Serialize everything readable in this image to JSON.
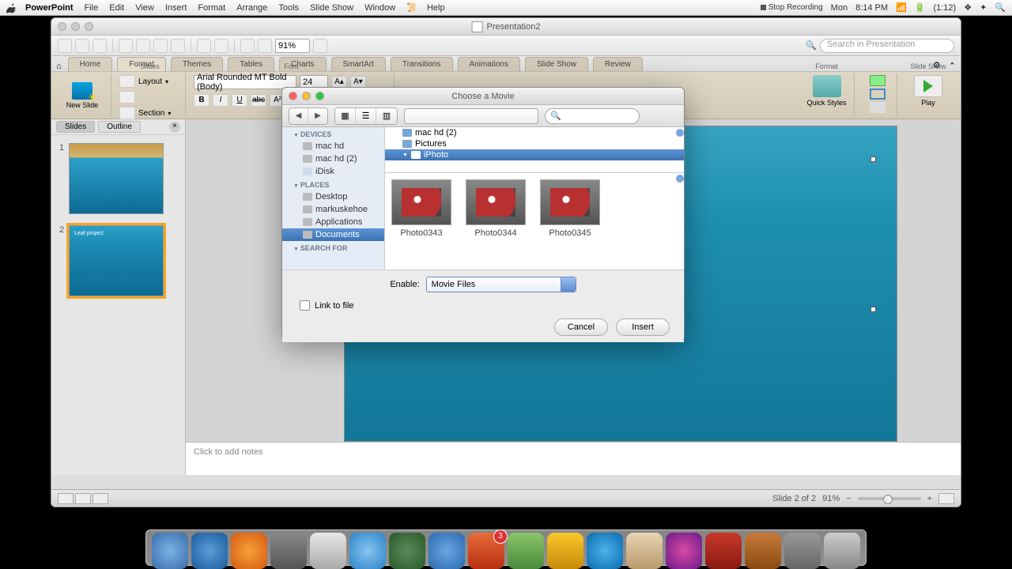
{
  "menubar": {
    "app": "PowerPoint",
    "items": [
      "File",
      "Edit",
      "View",
      "Insert",
      "Format",
      "Arrange",
      "Tools",
      "Slide Show",
      "Window",
      "Help"
    ],
    "right": {
      "stop_recording": "Stop Recording",
      "day": "Mon",
      "time": "8:14 PM",
      "battery": "(1:12)"
    }
  },
  "window": {
    "title": "Presentation2",
    "toolbar": {
      "zoom": "91%",
      "search_placeholder": "Search in Presentation"
    },
    "ribbon_tabs": [
      "Home",
      "Format",
      "Themes",
      "Tables",
      "Charts",
      "SmartArt",
      "Transitions",
      "Animations",
      "Slide Show",
      "Review"
    ],
    "ribbon": {
      "slides_label": "Slides",
      "new_slide": "New Slide",
      "layout": "Layout",
      "section": "Section",
      "font_label": "Font",
      "font_name": "Arial Rounded MT Bold (Body)",
      "font_size": "24",
      "format_group": "Format",
      "quick_styles": "Quick Styles",
      "slideshow_group": "Slide Show",
      "play": "Play"
    },
    "slide_tabs": {
      "slides": "Slides",
      "outline": "Outline"
    },
    "thumbs": [
      {
        "num": "1",
        "title": ""
      },
      {
        "num": "2",
        "title": "Leaf project"
      }
    ],
    "notes_placeholder": "Click to add notes",
    "status": {
      "slide": "Slide 2 of 2",
      "zoom": "91%"
    }
  },
  "dialog": {
    "title": "Choose a Movie",
    "search_icon": "🔍",
    "sidebar": {
      "devices": "DEVICES",
      "devices_items": [
        "mac hd",
        "mac hd (2)",
        "iDisk"
      ],
      "places": "PLACES",
      "places_items": [
        "Desktop",
        "markuskehoe",
        "Applications",
        "Documents"
      ],
      "search": "SEARCH FOR"
    },
    "filelist": [
      "mac hd (2)",
      "Pictures",
      "iPhoto"
    ],
    "grid": [
      "Photo0343",
      "Photo0344",
      "Photo0345"
    ],
    "enable_label": "Enable:",
    "enable_value": "Movie Files",
    "link_label": "Link to file",
    "cancel": "Cancel",
    "insert": "Insert"
  }
}
